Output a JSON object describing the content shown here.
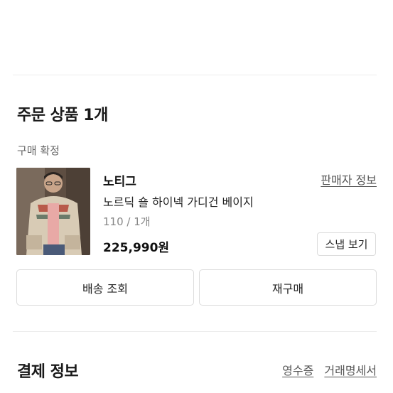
{
  "order_items": {
    "title": "주문 상품 1개",
    "status": "구매 확정",
    "product": {
      "brand": "노티그",
      "seller_info_label": "판매자 정보",
      "name": "노르딕 숄 하이넥 가디건 베이지",
      "option": "110 / 1개",
      "price": "225,990원",
      "snap_label": "스냅 보기",
      "image_icon": "product-photo"
    },
    "delivery_button": "배송 조회",
    "reorder_button": "재구매"
  },
  "payment": {
    "title": "결제 정보",
    "receipt_label": "영수증",
    "statement_label": "거래명세서"
  }
}
